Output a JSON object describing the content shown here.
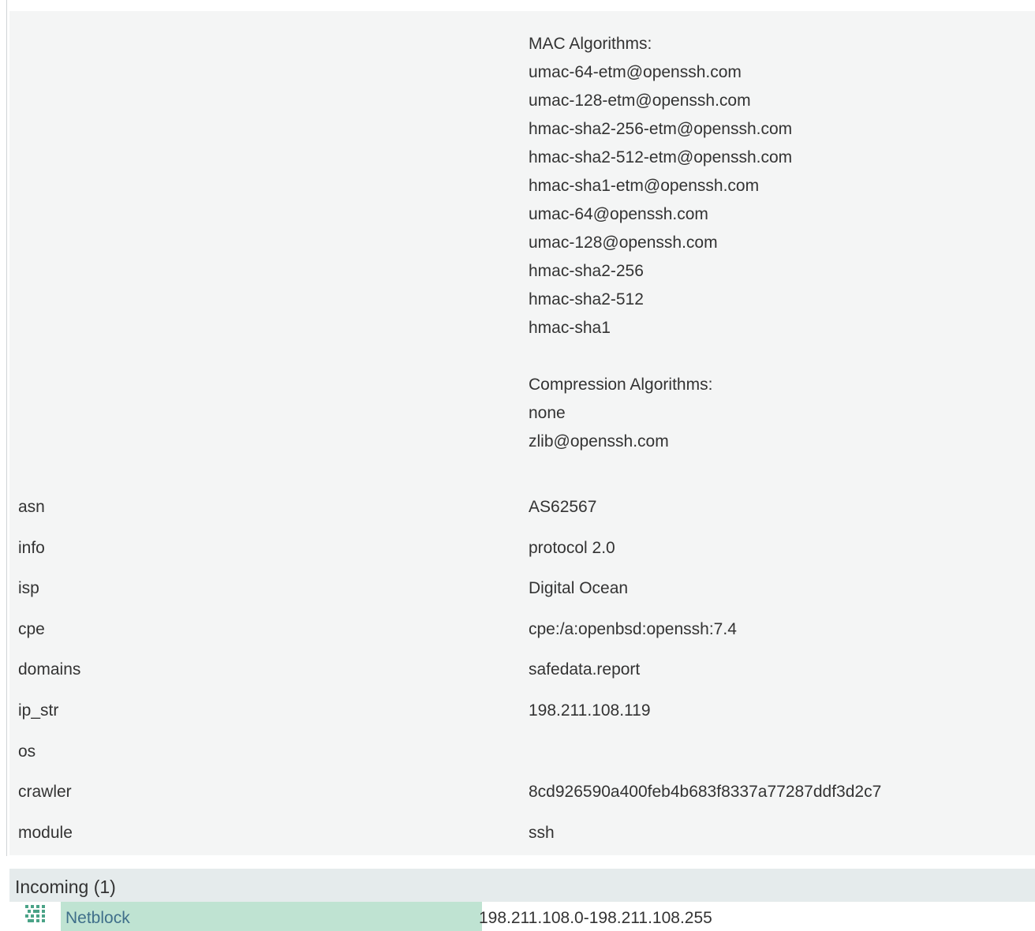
{
  "ssh_details": {
    "mac_title": "MAC Algorithms:",
    "mac_algorithms": [
      "umac-64-etm@openssh.com",
      "umac-128-etm@openssh.com",
      "hmac-sha2-256-etm@openssh.com",
      "hmac-sha2-512-etm@openssh.com",
      "hmac-sha1-etm@openssh.com",
      "umac-64@openssh.com",
      "umac-128@openssh.com",
      "hmac-sha2-256",
      "hmac-sha2-512",
      "hmac-sha1"
    ],
    "compression_title": "Compression Algorithms:",
    "compression_algorithms": [
      "none",
      "zlib@openssh.com"
    ]
  },
  "properties": [
    {
      "key": "asn",
      "value": "AS62567"
    },
    {
      "key": "info",
      "value": "protocol 2.0"
    },
    {
      "key": "isp",
      "value": "Digital Ocean"
    },
    {
      "key": "cpe",
      "value": "cpe:/a:openbsd:openssh:7.4"
    },
    {
      "key": "domains",
      "value": "safedata.report"
    },
    {
      "key": "ip_str",
      "value": "198.211.108.119"
    },
    {
      "key": "os",
      "value": ""
    },
    {
      "key": "crawler",
      "value": "8cd926590a400feb4b683f8337a77287ddf3d2c7"
    },
    {
      "key": "module",
      "value": "ssh"
    }
  ],
  "incoming": {
    "title": "Incoming (1)",
    "items": [
      {
        "icon": "netblock-icon",
        "type": "Netblock",
        "value": "198.211.108.0-198.211.108.255"
      }
    ]
  },
  "colors": {
    "panel_background": "#f4f5f5",
    "section_header": "#e5ebec",
    "entity_type_cell": "#bfe3d2",
    "entity_type_text": "#3f6f8a",
    "icon_green": "#4aa387",
    "text": "#333333"
  }
}
